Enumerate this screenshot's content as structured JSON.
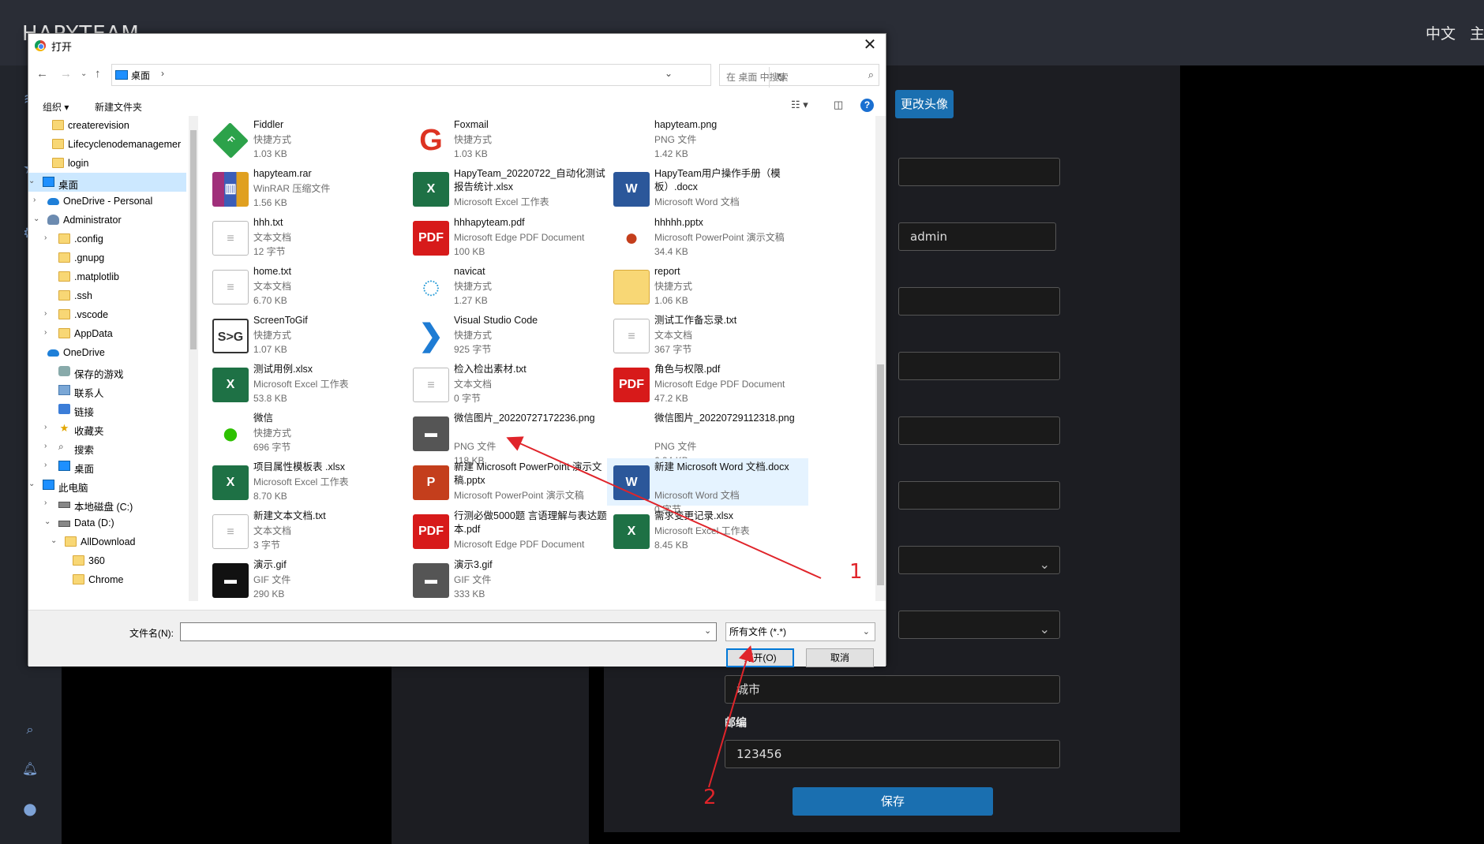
{
  "app": {
    "brand": "HAPYTEAM",
    "lang": "中文",
    "extra": "主"
  },
  "profile": {
    "change_avatar": "更改头像",
    "username": "admin",
    "city_placeholder": "城市",
    "zip_label": "邮编",
    "zip_value": "123456",
    "save": "保存"
  },
  "dialog": {
    "title": "打开",
    "close": "✕",
    "address": "桌面",
    "search_placeholder": "在 桌面 中搜索",
    "organize": "组织 ▾",
    "new_folder": "新建文件夹",
    "filename_label": "文件名(N):",
    "filename_value": "",
    "filetype": "所有文件 (*.*)",
    "open": "打开(O)",
    "cancel": "取消"
  },
  "tree": [
    {
      "label": "createrevision",
      "icon": "folder"
    },
    {
      "label": "Lifecyclenodemanagemer",
      "icon": "folder"
    },
    {
      "label": "login",
      "icon": "folder"
    },
    {
      "label": "桌面",
      "icon": "pc",
      "selected": true
    },
    {
      "label": "OneDrive - Personal",
      "icon": "cloud"
    },
    {
      "label": "Administrator",
      "icon": "user"
    },
    {
      "label": ".config",
      "icon": "folder"
    },
    {
      "label": ".gnupg",
      "icon": "folder"
    },
    {
      "label": ".matplotlib",
      "icon": "folder"
    },
    {
      "label": ".ssh",
      "icon": "folder"
    },
    {
      "label": ".vscode",
      "icon": "folder"
    },
    {
      "label": "AppData",
      "icon": "folder"
    },
    {
      "label": "OneDrive",
      "icon": "cloud"
    },
    {
      "label": "保存的游戏",
      "icon": "game"
    },
    {
      "label": "联系人",
      "icon": "contact"
    },
    {
      "label": "链接",
      "icon": "link"
    },
    {
      "label": "收藏夹",
      "icon": "star"
    },
    {
      "label": "搜索",
      "icon": "search"
    },
    {
      "label": "桌面",
      "icon": "pc"
    },
    {
      "label": "此电脑",
      "icon": "pc"
    },
    {
      "label": "本地磁盘 (C:)",
      "icon": "drive"
    },
    {
      "label": "Data (D:)",
      "icon": "drive"
    },
    {
      "label": "AllDownload",
      "icon": "folder"
    },
    {
      "label": "360",
      "icon": "folder"
    },
    {
      "label": "Chrome",
      "icon": "folder"
    }
  ],
  "files": [
    {
      "name": "Fiddler",
      "type": "快捷方式",
      "size": "1.03 KB",
      "icon": "fid"
    },
    {
      "name": "Foxmail",
      "type": "快捷方式",
      "size": "1.03 KB",
      "icon": "fox"
    },
    {
      "name": "hapyteam.png",
      "type": "PNG 文件",
      "size": "1.42 KB",
      "icon": "img"
    },
    {
      "name": "hapyteam.rar",
      "type": "WinRAR 压缩文件",
      "size": "1.56 KB",
      "icon": "rar"
    },
    {
      "name": "HapyTeam_20220722_自动化测试报告统计.xlsx",
      "type": "Microsoft Excel 工作表",
      "size": "",
      "icon": "xls"
    },
    {
      "name": "HapyTeam用户操作手册（模板）.docx",
      "type": "Microsoft Word 文档",
      "size": "",
      "icon": "doc"
    },
    {
      "name": "hhh.txt",
      "type": "文本文档",
      "size": "12 字节",
      "icon": "txt"
    },
    {
      "name": "hhhapyteam.pdf",
      "type": "Microsoft Edge PDF Document",
      "size": "100 KB",
      "icon": "pdf"
    },
    {
      "name": "hhhhh.pptx",
      "type": "Microsoft PowerPoint 演示文稿",
      "size": "34.4 KB",
      "icon": "pptx"
    },
    {
      "name": "home.txt",
      "type": "文本文档",
      "size": "6.70 KB",
      "icon": "txt"
    },
    {
      "name": "navicat",
      "type": "快捷方式",
      "size": "1.27 KB",
      "icon": "nav"
    },
    {
      "name": "report",
      "type": "快捷方式",
      "size": "1.06 KB",
      "icon": "fold"
    },
    {
      "name": "ScreenToGif",
      "type": "快捷方式",
      "size": "1.07 KB",
      "icon": "s2g"
    },
    {
      "name": "Visual Studio Code",
      "type": "快捷方式",
      "size": "925 字节",
      "icon": "vsc"
    },
    {
      "name": "测试工作备忘录.txt",
      "type": "文本文档",
      "size": "367 字节",
      "icon": "txt"
    },
    {
      "name": "测试用例.xlsx",
      "type": "Microsoft Excel 工作表",
      "size": "53.8 KB",
      "icon": "xls"
    },
    {
      "name": "检入检出素材.txt",
      "type": "文本文档",
      "size": "0 字节",
      "icon": "txt"
    },
    {
      "name": "角色与权限.pdf",
      "type": "Microsoft Edge PDF Document",
      "size": "47.2 KB",
      "icon": "pdf"
    },
    {
      "name": "微信",
      "type": "快捷方式",
      "size": "696 字节",
      "icon": "wx"
    },
    {
      "name": "微信图片_20220727172236.png",
      "type": "PNG 文件",
      "size": "118 KB",
      "icon": "gif2"
    },
    {
      "name": "微信图片_20220729112318.png",
      "type": "PNG 文件",
      "size": "6.94 KB",
      "icon": "img"
    },
    {
      "name": "项目属性模板表 .xlsx",
      "type": "Microsoft Excel 工作表",
      "size": "8.70 KB",
      "icon": "xls"
    },
    {
      "name": "新建 Microsoft PowerPoint 演示文稿.pptx",
      "type": "Microsoft PowerPoint 演示文稿",
      "size": "",
      "icon": "ppt"
    },
    {
      "name": "新建 Microsoft Word 文档.docx",
      "type": "Microsoft Word 文档",
      "size": "0 字节",
      "icon": "doc",
      "highlight": true
    },
    {
      "name": "新建文本文档.txt",
      "type": "文本文档",
      "size": "3 字节",
      "icon": "txt"
    },
    {
      "name": "行测必做5000题 言语理解与表达题本.pdf",
      "type": "Microsoft Edge PDF Document",
      "size": "",
      "icon": "pdf"
    },
    {
      "name": "需求变更记录.xlsx",
      "type": "Microsoft Excel 工作表",
      "size": "8.45 KB",
      "icon": "xls"
    },
    {
      "name": "演示.gif",
      "type": "GIF 文件",
      "size": "290 KB",
      "icon": "gif"
    },
    {
      "name": "演示3.gif",
      "type": "GIF 文件",
      "size": "333 KB",
      "icon": "gif2"
    }
  ],
  "icon_glyphs": {
    "fid": "F",
    "fox": "G",
    "nav": "◌",
    "vsc": "❯",
    "wx": "●",
    "s2g": "S>G",
    "xls": "X",
    "doc": "W",
    "pdf": "PDF",
    "ppt": "P",
    "pptx": "●",
    "txt": "≡",
    "rar": "▥",
    "img": "▬",
    "gif": "▬",
    "gif2": "▬",
    "fold": ""
  },
  "annotations": {
    "one": "1",
    "two": "2"
  },
  "colors": {
    "accent": "#1a6fb0",
    "arrow": "#e0242a",
    "selected": "#cce8ff"
  }
}
